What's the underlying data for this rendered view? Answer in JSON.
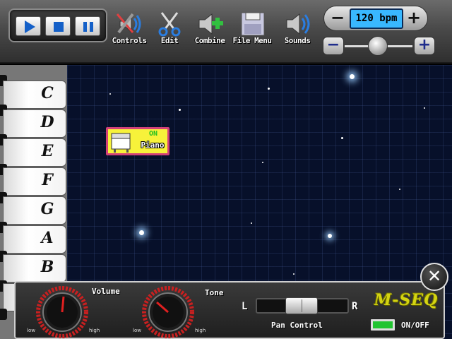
{
  "toolbar": {
    "transport": {
      "play_icon": "play-icon",
      "stop_icon": "stop-icon",
      "pause_icon": "pause-icon"
    },
    "tools": [
      {
        "label": "Controls",
        "icon": "wrench-screwdriver-speaker-icon"
      },
      {
        "label": "Edit",
        "icon": "scissors-icon"
      },
      {
        "label": "Combine",
        "icon": "speaker-plus-icon"
      },
      {
        "label": "File Menu",
        "icon": "floppy-disk-icon"
      },
      {
        "label": "Sounds",
        "icon": "speaker-waves-icon"
      }
    ],
    "tempo": {
      "minus": "−",
      "plus": "+",
      "display": "120 bpm"
    },
    "slider": {
      "minus": "−",
      "plus": "+",
      "position_fraction": 0.5
    }
  },
  "keys": [
    "C",
    "D",
    "E",
    "F",
    "G",
    "A",
    "B"
  ],
  "instrument": {
    "state": "ON",
    "name": "Piano",
    "icon": "piano-icon",
    "border_color": "#d24178",
    "fill_color": "#f7f23a"
  },
  "panel": {
    "volume": {
      "label": "Volume",
      "low": "low",
      "high": "high",
      "level_fraction": 0.52
    },
    "tone": {
      "label": "Tone",
      "low": "low",
      "high": "high",
      "level_fraction": 0.32
    },
    "pan": {
      "label": "Pan Control",
      "left": "L",
      "right": "R",
      "position_fraction": 0.5
    },
    "logo": "M-SEQ",
    "onoff_label": "ON/OFF"
  },
  "close": "✕",
  "colors": {
    "accent_blue": "#39b8ff",
    "space_bg": "#07102a",
    "knob_red": "#e02020",
    "logo_yellow": "#d4d412"
  }
}
